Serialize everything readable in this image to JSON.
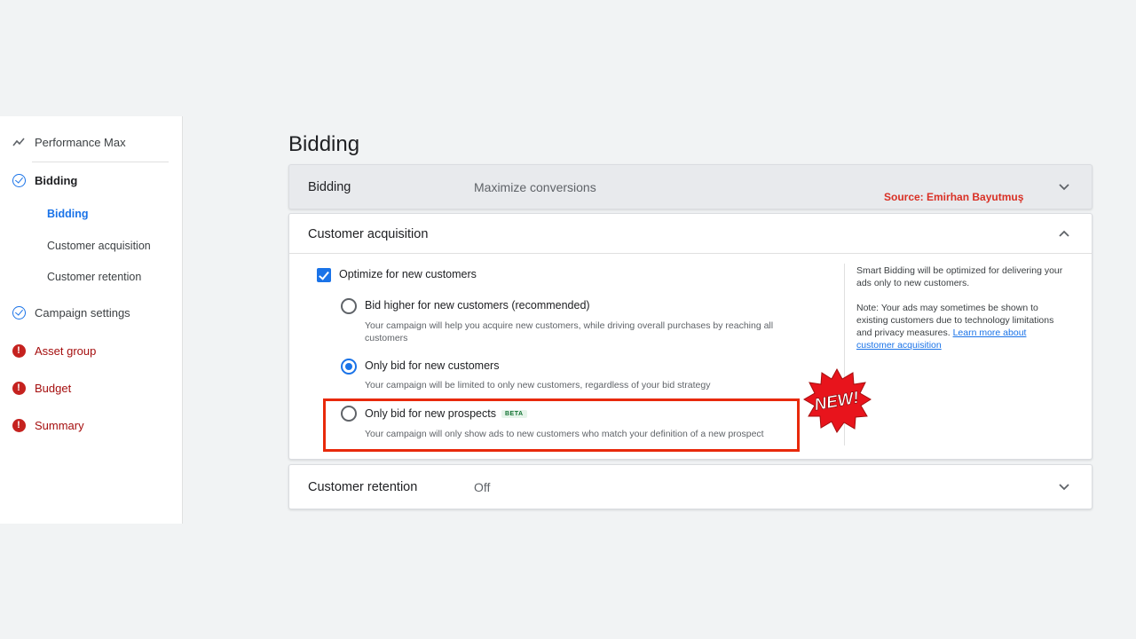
{
  "sidebar": {
    "items": [
      {
        "label": "Performance Max",
        "icon": "trending-icon",
        "status": "none"
      },
      {
        "label": "Bidding",
        "icon": "check-circle-icon",
        "status": "complete"
      },
      {
        "label": "Campaign settings",
        "icon": "check-circle-icon",
        "status": "complete"
      },
      {
        "label": "Asset group",
        "icon": "error-icon",
        "status": "error"
      },
      {
        "label": "Budget",
        "icon": "error-icon",
        "status": "error"
      },
      {
        "label": "Summary",
        "icon": "error-icon",
        "status": "error"
      }
    ],
    "sub_items": [
      {
        "label": "Bidding",
        "active": true
      },
      {
        "label": "Customer acquisition",
        "active": false
      },
      {
        "label": "Customer retention",
        "active": false
      }
    ]
  },
  "page": {
    "title": "Bidding"
  },
  "bidding_panel": {
    "title": "Bidding",
    "value": "Maximize conversions",
    "source": "Source: Emirhan Bayutmuş"
  },
  "acquisition_panel": {
    "title": "Customer acquisition",
    "checkbox_label": "Optimize for new customers",
    "checkbox_checked": true,
    "options": [
      {
        "label": "Bid higher for new customers (recommended)",
        "description": "Your campaign will help you acquire new customers, while driving overall purchases by reaching all customers",
        "selected": false
      },
      {
        "label": "Only bid for new customers",
        "description": "Your campaign will be limited to only new customers, regardless of your bid strategy",
        "selected": true
      },
      {
        "label": "Only bid for new prospects",
        "badge": "BETA",
        "description": "Your campaign will only show ads to new customers who match your definition of a new prospect",
        "selected": false
      }
    ],
    "side_note_1": "Smart Bidding will be optimized for delivering your ads only to new customers.",
    "side_note_2": "Note: Your ads may sometimes be shown to existing customers due to technology limitations and privacy measures.",
    "learn_more": "Learn more about customer acquisition"
  },
  "retention_panel": {
    "title": "Customer retention",
    "value": "Off"
  },
  "new_badge": "NEW!",
  "colors": {
    "accent": "#1a73e8",
    "error": "#c5221f",
    "highlight": "#e8290b",
    "source_text": "#d93025"
  }
}
